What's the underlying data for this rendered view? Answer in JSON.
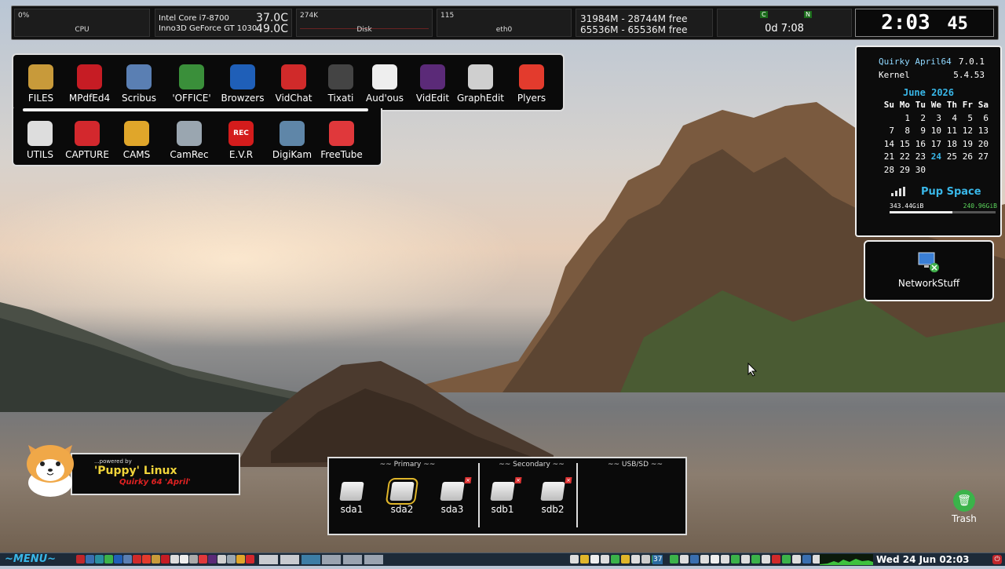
{
  "top_bar": {
    "cpu": {
      "percent": "0%",
      "label": "CPU"
    },
    "temps": {
      "cpu_name": "Intel Core i7-8700",
      "cpu_temp": "37.0C",
      "gpu_name": "Inno3D GeForce GT 1030",
      "gpu_temp": "49.0C"
    },
    "disk": {
      "value": "274K",
      "label": "Disk"
    },
    "net": {
      "value": "115",
      "label": "eth0"
    },
    "memory": {
      "ram": "31984M - 28744M free",
      "swap": "65536M - 65536M free"
    },
    "uptime": {
      "c_label": "C",
      "n_label": "N",
      "value": "0d 7:08"
    },
    "clock": {
      "time": "2:03",
      "seconds": "45"
    }
  },
  "launcher_row1": [
    {
      "label": "FILES",
      "icon": "folder-icon",
      "color": "#c89a3a"
    },
    {
      "label": "MPdfEd4",
      "icon": "pdf-editor-icon",
      "color": "#c61c24"
    },
    {
      "label": "Scribus",
      "icon": "scribus-icon",
      "color": "#5a7fb3"
    },
    {
      "label": "'OFFICE'",
      "icon": "office-icon",
      "color": "#3a8f3a"
    },
    {
      "label": "Browzers",
      "icon": "globe-icon",
      "color": "#1f5fb8"
    },
    {
      "label": "VidChat",
      "icon": "video-chat-icon",
      "color": "#d02a2a"
    },
    {
      "label": "Tixati",
      "icon": "tixati-icon",
      "color": "#444444"
    },
    {
      "label": "Aud'ous",
      "icon": "audio-icon",
      "color": "#eeeeee"
    },
    {
      "label": "VidEdit",
      "icon": "film-icon",
      "color": "#5b2a78"
    },
    {
      "label": "GraphEdit",
      "icon": "pencil-icon",
      "color": "#cfcfcf"
    },
    {
      "label": "Plyers",
      "icon": "player-icon",
      "color": "#e33b2d"
    }
  ],
  "launcher_row2": [
    {
      "label": "UTILS",
      "icon": "tools-icon",
      "color": "#dddddd"
    },
    {
      "label": "CAPTURE",
      "icon": "camera-icon",
      "color": "#d3282d"
    },
    {
      "label": "CAMS",
      "icon": "cams-icon",
      "color": "#e0a62a"
    },
    {
      "label": "CamRec",
      "icon": "webcam-icon",
      "color": "#9aa6b0"
    },
    {
      "label": "E.V.R",
      "icon": "rec-icon",
      "color": "#d41c1c",
      "text": "REC"
    },
    {
      "label": "DigiKam",
      "icon": "lens-icon",
      "color": "#5f86a8"
    },
    {
      "label": "FreeTube",
      "icon": "freetube-icon",
      "color": "#e0383b"
    }
  ],
  "sysinfo": {
    "distro_label": "Quirky April64",
    "distro_version": "7.0.1",
    "kernel_label": "Kernel",
    "kernel_version": "5.4.53",
    "month": "June",
    "year": "2026",
    "weekdays": [
      "Su",
      "Mo",
      "Tu",
      "We",
      "Th",
      "Fr",
      "Sa"
    ],
    "weeks": [
      [
        "",
        "1",
        "2",
        "3",
        "4",
        "5",
        "6"
      ],
      [
        "7",
        "8",
        "9",
        "10",
        "11",
        "12",
        "13"
      ],
      [
        "14",
        "15",
        "16",
        "17",
        "18",
        "19",
        "20"
      ],
      [
        "21",
        "22",
        "23",
        "24",
        "25",
        "26",
        "27"
      ],
      [
        "28",
        "29",
        "30",
        "",
        "",
        "",
        ""
      ]
    ],
    "today": "24",
    "pup_space_label": "Pup Space",
    "used": "343.44GiB",
    "free": "240.96GiB",
    "used_fraction": 0.59
  },
  "network": {
    "label": "NetworkStuff",
    "icon": "network-icon"
  },
  "puppy": {
    "powered_by": "...powered by",
    "title": "'Puppy' Linux",
    "subtitle": "Quirky 64 'April'"
  },
  "drives": {
    "primary_label": "~~ Primary ~~",
    "secondary_label": "~~ Secondary ~~",
    "usb_label": "~~ USB/SD ~~",
    "items": [
      "sda1",
      "sda2",
      "sda3",
      "sdb1",
      "sdb2"
    ]
  },
  "trash": {
    "label": "Trash"
  },
  "taskbar": {
    "menu_label": "~MENU~",
    "tray_number": "37",
    "datetime": "Wed 24 Jun 02:03"
  }
}
